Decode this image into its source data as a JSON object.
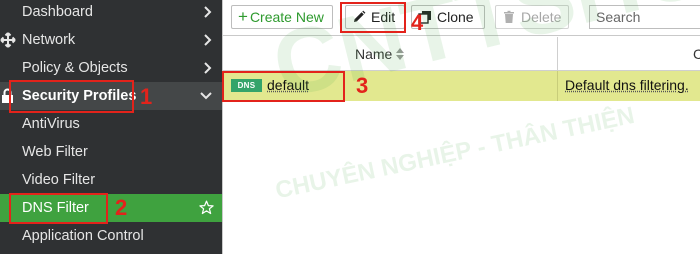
{
  "sidebar": {
    "items": [
      {
        "label": "Dashboard"
      },
      {
        "label": "Network"
      },
      {
        "label": "Policy & Objects"
      },
      {
        "label": "Security Profiles"
      },
      {
        "label": "AntiVirus"
      },
      {
        "label": "Web Filter"
      },
      {
        "label": "Video Filter"
      },
      {
        "label": "DNS Filter"
      },
      {
        "label": "Application Control"
      }
    ]
  },
  "toolbar": {
    "create_label": "Create New",
    "edit_label": "Edit",
    "clone_label": "Clone",
    "delete_label": "Delete",
    "search_placeholder": "Search"
  },
  "table": {
    "columns": [
      "Name",
      "C"
    ],
    "rows": [
      {
        "badge": "DNS",
        "name": "default",
        "comment": "Default dns filtering."
      }
    ]
  },
  "annotations": {
    "step1": "1",
    "step2": "2",
    "step3": "3",
    "step4": "4"
  },
  "watermark": {
    "brand": "CNTTSHOP.vn",
    "tagline": "CHUYÊN NGHIỆP - THÂN THIỆN"
  },
  "colors": {
    "sidebar_bg": "#2f3133",
    "selected_bg": "#3fa23f",
    "row_highlight": "#e2e88f",
    "annotation_red": "#e3231b",
    "badge_green": "#34a46a"
  }
}
